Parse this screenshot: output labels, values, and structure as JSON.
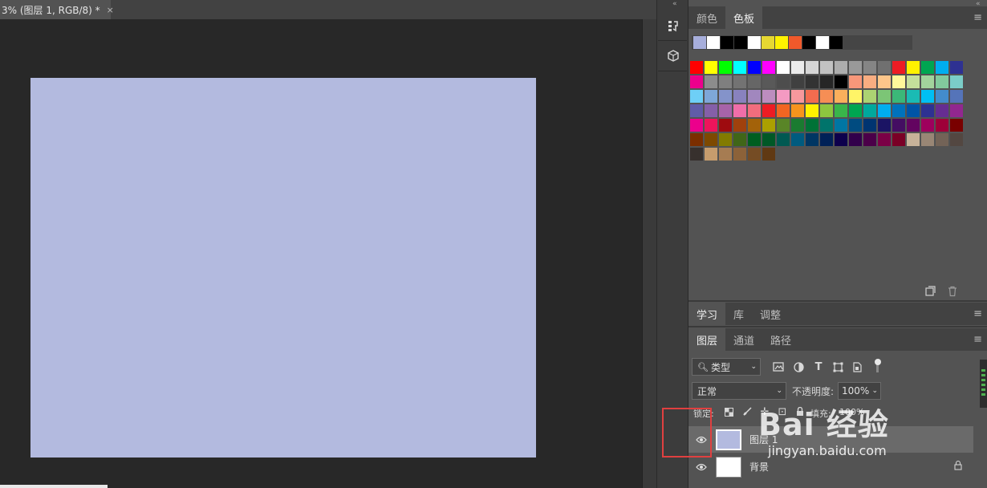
{
  "document": {
    "tab_title": "3% (图层 1, RGB/8) *",
    "close_glyph": "×",
    "canvas_color": "#b3badf"
  },
  "dock": {
    "buttons": [
      {
        "name": "history-panel-icon",
        "glyph": "⇆"
      },
      {
        "name": "3d-panel-icon",
        "glyph": "⧉"
      }
    ]
  },
  "swatches_panel": {
    "tabs": [
      {
        "label": "颜色",
        "active": false
      },
      {
        "label": "色板",
        "active": true
      }
    ],
    "menu_glyph": "≡",
    "recent": [
      "#a7aedb",
      "#ffffff",
      "#000000",
      "#000000",
      "#ffffff",
      "#e6d832",
      "#fff200",
      "#f0592b",
      "#000000",
      "#ffffff",
      "#000000"
    ],
    "colors": [
      "#ff0000",
      "#ffff00",
      "#00ff00",
      "#00ffff",
      "#0000ff",
      "#ff00ff",
      "#ffffff",
      "#ebebeb",
      "#d6d6d6",
      "#c2c2c2",
      "#adadad",
      "#999999",
      "#858585",
      "#707070",
      "#ed1c24",
      "#fff200",
      "#00a651",
      "#00aeef",
      "#2e3192",
      "#ec008c",
      "#8c8c8c",
      "#7f7f7f",
      "#737373",
      "#666666",
      "#595959",
      "#4d4d4d",
      "#404040",
      "#333333",
      "#262626",
      "#000000",
      "#f7977a",
      "#f9ad81",
      "#fdc68a",
      "#fff79a",
      "#c4df9b",
      "#a2d39c",
      "#82ca9d",
      "#7bcdc8",
      "#6ecff6",
      "#7ea7d8",
      "#8493ca",
      "#8882be",
      "#a187be",
      "#bc8dbf",
      "#f49ac2",
      "#f6989d",
      "#f26c4f",
      "#f68e55",
      "#fbaf5c",
      "#fff467",
      "#acd372",
      "#7cc576",
      "#3bb878",
      "#1abbb4",
      "#00bff3",
      "#438ccb",
      "#5574b9",
      "#605ca8",
      "#855fa8",
      "#a763a8",
      "#f06ea9",
      "#f26d7d",
      "#ed1c24",
      "#f26522",
      "#f7941d",
      "#fff200",
      "#8dc73f",
      "#39b54a",
      "#00a651",
      "#00a99d",
      "#00aeef",
      "#0072bc",
      "#0054a6",
      "#2e3192",
      "#662d91",
      "#92278f",
      "#ec008c",
      "#ed145b",
      "#9e0b0f",
      "#a0410d",
      "#a36209",
      "#aba000",
      "#598527",
      "#1a7b30",
      "#007236",
      "#00746b",
      "#0076a3",
      "#004b80",
      "#003471",
      "#1b1464",
      "#440e62",
      "#630460",
      "#9e005d",
      "#9e0039",
      "#790000",
      "#7b2e00",
      "#7d4900",
      "#827b00",
      "#406618",
      "#005e20",
      "#005826",
      "#005952",
      "#005b7f",
      "#003663",
      "#002157",
      "#0d004c",
      "#32004b",
      "#4b0049",
      "#7b0046",
      "#7a0026",
      "#c7b299",
      "#998675",
      "#736357",
      "#534741",
      "#37302d",
      "#c69c6d",
      "#a67c52",
      "#8c6239",
      "#754c24",
      "#603913"
    ],
    "footer_icons": [
      "new-swatch-icon",
      "trash-icon"
    ]
  },
  "learn_panel": {
    "tabs": [
      {
        "label": "学习",
        "active": true
      },
      {
        "label": "库",
        "active": false
      },
      {
        "label": "调整",
        "active": false
      }
    ]
  },
  "layers_panel": {
    "tabs": [
      {
        "label": "图层",
        "active": true
      },
      {
        "label": "通道",
        "active": false
      },
      {
        "label": "路径",
        "active": false
      }
    ],
    "filter_value": "类型",
    "blend_mode": "正常",
    "opacity_label": "不透明度:",
    "opacity_value": "100%",
    "lock_label": "锁定:",
    "fill_label": "填充:",
    "fill_value": "100%",
    "layers": [
      {
        "name": "图层 1",
        "thumb": "#b3badf",
        "selected": true,
        "locked": false
      },
      {
        "name": "背景",
        "thumb": "#ffffff",
        "selected": false,
        "locked": true
      }
    ]
  },
  "watermark": {
    "main": "Bai 经验",
    "sub": "jingyan.baidu.com"
  }
}
